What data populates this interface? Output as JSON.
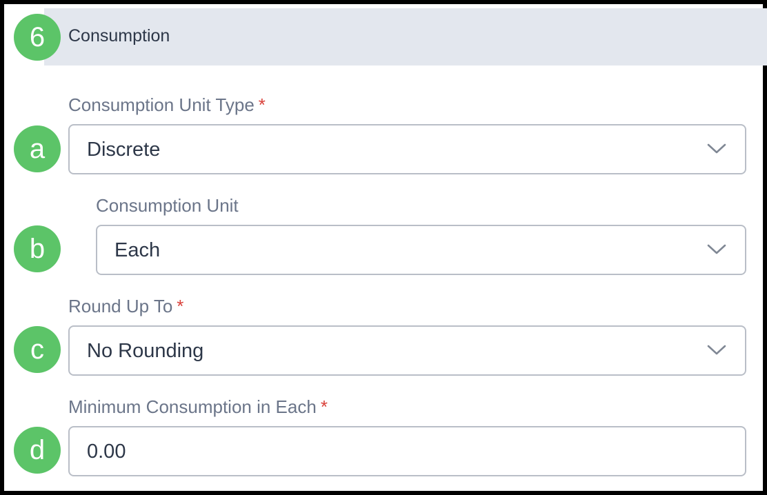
{
  "section": {
    "number": "6",
    "title": "Consumption"
  },
  "fields": {
    "unit_type": {
      "badge": "a",
      "label": "Consumption Unit Type",
      "required_mark": "*",
      "value": "Discrete"
    },
    "unit": {
      "badge": "b",
      "label": "Consumption Unit",
      "value": "Each"
    },
    "round_up": {
      "badge": "c",
      "label": "Round Up To",
      "required_mark": "*",
      "value": "No Rounding"
    },
    "min_consumption": {
      "badge": "d",
      "label": "Minimum Consumption in Each",
      "required_mark": "*",
      "value": "0.00"
    }
  },
  "colors": {
    "badge": "#5cc468",
    "header_background": "#e3e7ee",
    "required": "#d9413a",
    "label": "#6b7589"
  },
  "icons": {
    "dropdown": "chevron-down-icon"
  }
}
